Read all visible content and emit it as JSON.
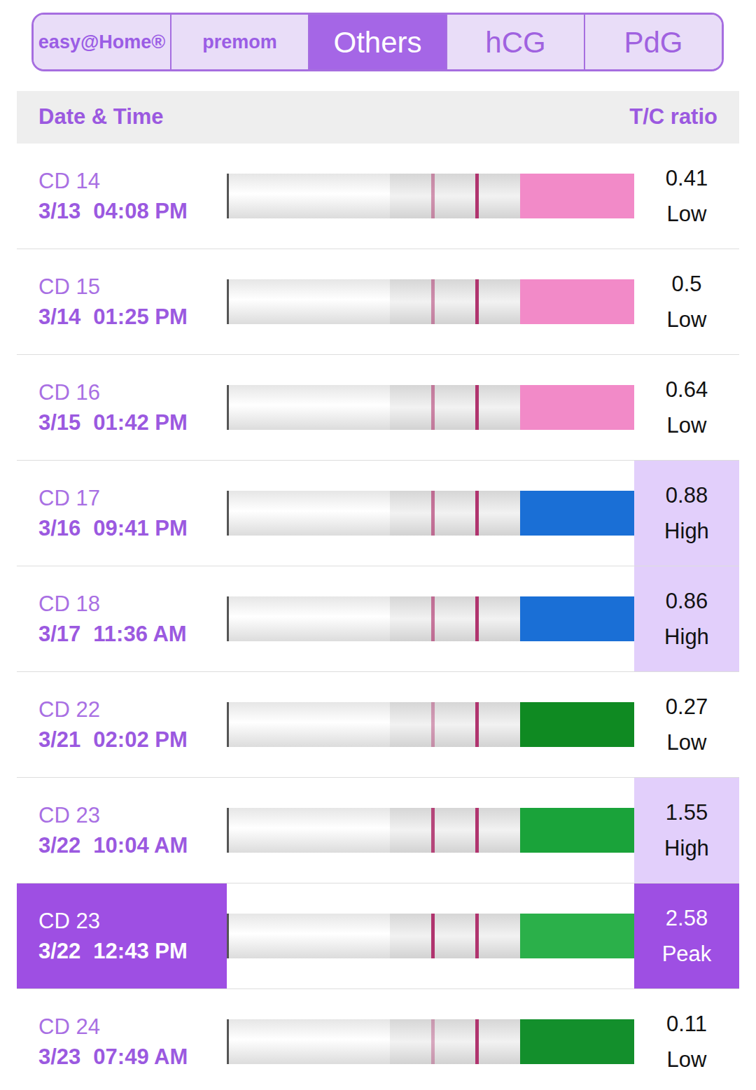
{
  "tabs": [
    {
      "label": "easy@Home®",
      "kind": "logo",
      "selected": false
    },
    {
      "label": "premom",
      "kind": "logo",
      "selected": false
    },
    {
      "label": "Others",
      "kind": "text",
      "selected": true
    },
    {
      "label": "hCG",
      "kind": "text",
      "selected": false
    },
    {
      "label": "PdG",
      "kind": "text",
      "selected": false
    }
  ],
  "header": {
    "date_time": "Date & Time",
    "ratio": "T/C ratio"
  },
  "rows": [
    {
      "cycle_day": "CD 14",
      "date": "3/13",
      "time": "04:08 PM",
      "ratio": "0.41",
      "level": "Low",
      "kind": "low",
      "strip_color": "#f28ac8"
    },
    {
      "cycle_day": "CD 15",
      "date": "3/14",
      "time": "01:25 PM",
      "ratio": "0.5",
      "level": "Low",
      "kind": "low",
      "strip_color": "#f28ac8"
    },
    {
      "cycle_day": "CD 16",
      "date": "3/15",
      "time": "01:42 PM",
      "ratio": "0.64",
      "level": "Low",
      "kind": "low",
      "strip_color": "#f28ac8"
    },
    {
      "cycle_day": "CD 17",
      "date": "3/16",
      "time": "09:41 PM",
      "ratio": "0.88",
      "level": "High",
      "kind": "high",
      "strip_color": "#1a6fd6"
    },
    {
      "cycle_day": "CD 18",
      "date": "3/17",
      "time": "11:36 AM",
      "ratio": "0.86",
      "level": "High",
      "kind": "high",
      "strip_color": "#1a6fd6"
    },
    {
      "cycle_day": "CD 22",
      "date": "3/21",
      "time": "02:02 PM",
      "ratio": "0.27",
      "level": "Low",
      "kind": "low",
      "strip_color": "#0f8a22"
    },
    {
      "cycle_day": "CD 23",
      "date": "3/22",
      "time": "10:04 AM",
      "ratio": "1.55",
      "level": "High",
      "kind": "high",
      "strip_color": "#1aa33a"
    },
    {
      "cycle_day": "CD 23",
      "date": "3/22",
      "time": "12:43 PM",
      "ratio": "2.58",
      "level": "Peak",
      "kind": "peak",
      "strip_color": "#2bb04a"
    },
    {
      "cycle_day": "CD 24",
      "date": "3/23",
      "time": "07:49 AM",
      "ratio": "0.11",
      "level": "Low",
      "kind": "low",
      "strip_color": "#138f2c"
    }
  ]
}
